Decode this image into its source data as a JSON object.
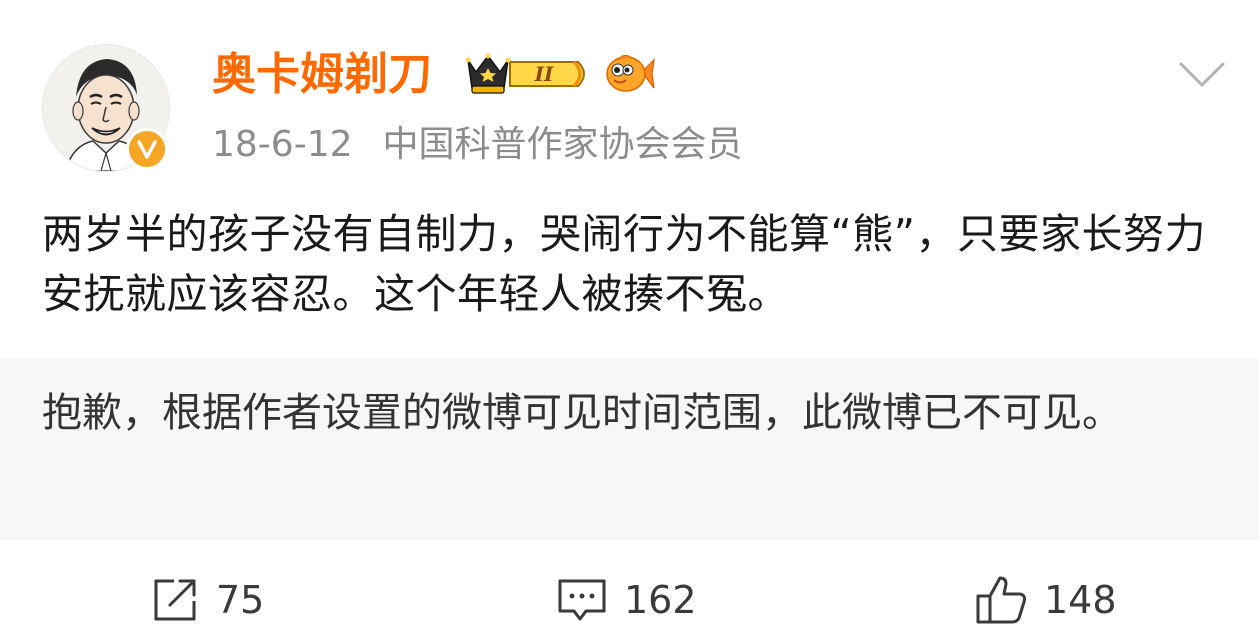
{
  "post": {
    "user": {
      "name": "奥卡姆剃刀",
      "verified_badge": "V",
      "level_badge": "II",
      "icons": [
        "avatar-portrait",
        "verified-v-icon",
        "crown-level-icon",
        "fish-icon"
      ]
    },
    "date": "18-6-12",
    "source": "中国科普作家协会会员",
    "text": "两岁半的孩子没有自制力，哭闹行为不能算“熊”，只要家长努力安抚就应该容忍。这个年轻人被揍不冤。",
    "notice": "抱歉，根据作者设置的微博可见时间范围，此微博已不可见。"
  },
  "actions": {
    "repost": {
      "icon": "share-icon",
      "count": "75"
    },
    "comment": {
      "icon": "comment-icon",
      "count": "162"
    },
    "like": {
      "icon": "thumbs-up-icon",
      "count": "148"
    }
  },
  "colors": {
    "username": "#ff6a00",
    "verified": "#f5a623",
    "meta_text": "#8c8c8c",
    "notice_bg": "#f7f7f7"
  }
}
